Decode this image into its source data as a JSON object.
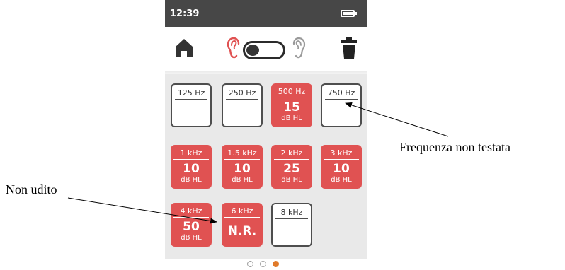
{
  "status": {
    "time": "12:39"
  },
  "toolbar": {
    "icons": [
      "home-icon",
      "left-ear-icon",
      "ear-toggle",
      "right-ear-icon",
      "trash-icon"
    ],
    "accent_color": "#e05252"
  },
  "tiles": [
    {
      "freq": "125 Hz",
      "value": "",
      "unit": "",
      "tested": false
    },
    {
      "freq": "250 Hz",
      "value": "",
      "unit": "",
      "tested": false
    },
    {
      "freq": "500 Hz",
      "value": "15",
      "unit": "dB HL",
      "tested": true
    },
    {
      "freq": "750 Hz",
      "value": "",
      "unit": "",
      "tested": false
    },
    {
      "freq": "1 kHz",
      "value": "10",
      "unit": "dB HL",
      "tested": true
    },
    {
      "freq": "1.5 kHz",
      "value": "10",
      "unit": "dB HL",
      "tested": true
    },
    {
      "freq": "2 kHz",
      "value": "25",
      "unit": "dB HL",
      "tested": true
    },
    {
      "freq": "3 kHz",
      "value": "10",
      "unit": "dB HL",
      "tested": true
    },
    {
      "freq": "4 kHz",
      "value": "50",
      "unit": "dB HL",
      "tested": true
    },
    {
      "freq": "6 kHz",
      "value": "N.R.",
      "unit": "",
      "tested": true
    },
    {
      "freq": "8 kHz",
      "value": "",
      "unit": "",
      "tested": false
    }
  ],
  "pagination": {
    "count": 3,
    "active": 3,
    "active_color": "#e07a2a"
  },
  "annotations": {
    "untested": "Frequenza non testata",
    "not_heard": "Non udito"
  }
}
